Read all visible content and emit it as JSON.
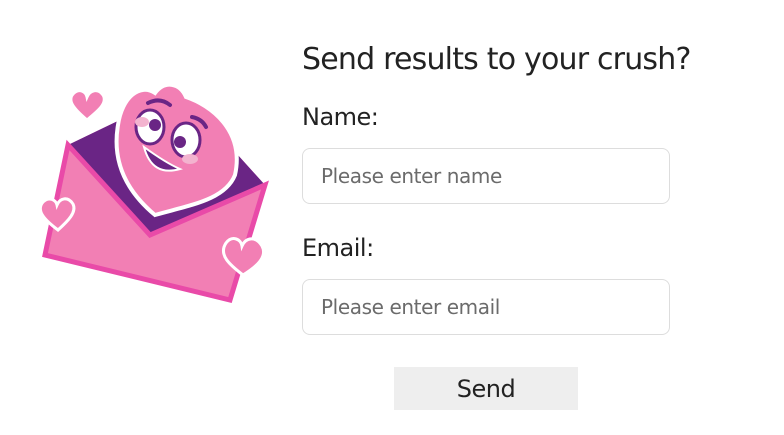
{
  "form": {
    "title": "Send results to your crush?",
    "name_label": "Name:",
    "name_placeholder": "Please enter name",
    "name_value": "",
    "email_label": "Email:",
    "email_placeholder": "Please enter email",
    "email_value": "",
    "send_label": "Send"
  },
  "illustration": {
    "icon": "love-letter-heart-illustration",
    "colors": {
      "pink_dark": "#e94aa8",
      "pink": "#f27fb4",
      "pink_light": "#f6a0c8",
      "purple": "#6a2585",
      "cheek": "#f3b3cf"
    }
  },
  "colors": {
    "text": "#222222",
    "input_border": "#dddddd",
    "button_bg": "#eeeeee"
  }
}
